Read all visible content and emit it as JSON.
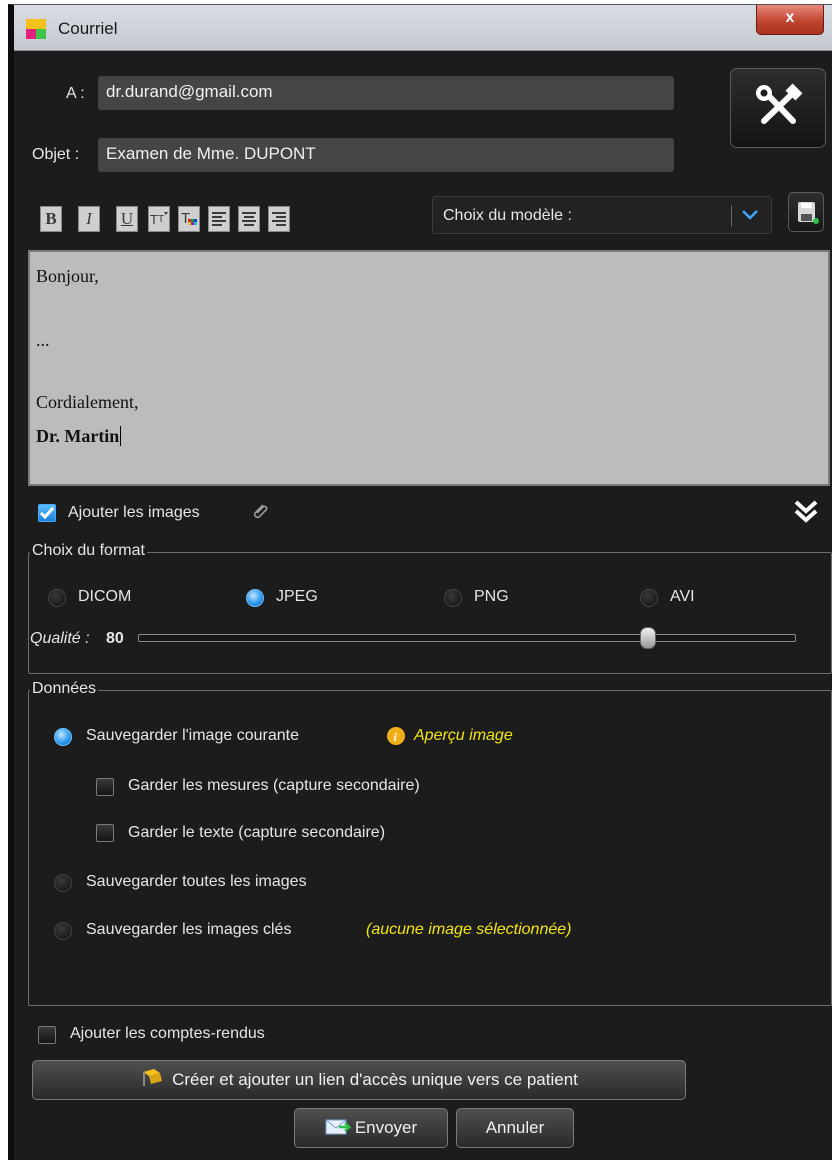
{
  "window": {
    "title": "Courriel",
    "close_label": "x"
  },
  "form": {
    "to_label": "A :",
    "to_value": "dr.durand@gmail.com",
    "subject_label": "Objet :",
    "subject_value": "Examen de Mme. DUPONT"
  },
  "toolbar": {
    "bold": "B",
    "italic": "I",
    "underline": "U",
    "model_select_value": "Choix du modèle :"
  },
  "editor": {
    "line1": "Bonjour,",
    "line2": "...",
    "line3": "Cordialement,",
    "line4": "Dr. Martin"
  },
  "attach_images": {
    "label": "Ajouter les images",
    "checked": true
  },
  "format_group": {
    "legend": "Choix du format",
    "options": [
      "DICOM",
      "JPEG",
      "PNG",
      "AVI"
    ],
    "selected": "JPEG",
    "quality_label": "Qualité :",
    "quality_value": "80"
  },
  "data_group": {
    "legend": "Données",
    "save_current": "Sauvegarder l'image courante",
    "preview_link": "Aperçu image",
    "keep_measures": "Garder les mesures (capture secondaire)",
    "keep_text": "Garder le texte (capture secondaire)",
    "save_all": "Sauvegarder toutes les images",
    "save_key": "Sauvegarder les images clés",
    "key_note": "(aucune image sélectionnée)"
  },
  "reports": {
    "label": "Ajouter les comptes-rendus",
    "checked": false
  },
  "buttons": {
    "create_link": "Créer et ajouter un lien d'accès unique vers ce patient",
    "send": "Envoyer",
    "cancel": "Annuler"
  },
  "colors": {
    "accent": "#2f9bf0",
    "highlight_text": "#f2e600",
    "background": "#1c1c1c"
  }
}
